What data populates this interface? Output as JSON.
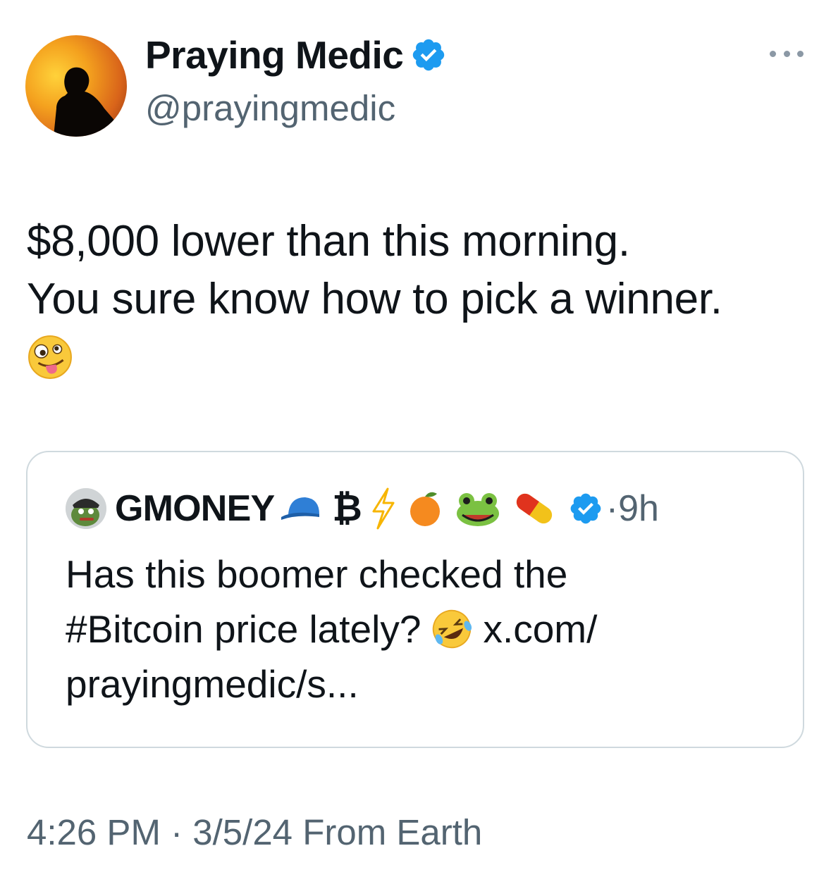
{
  "author": {
    "name": "Praying Medic",
    "handle": "@prayingmedic",
    "verified": true,
    "avatar_icon": "silhouette-sunset-avatar"
  },
  "tweet": {
    "line1": "$8,000 lower than this morning.",
    "line2": "You sure know how to pick a winner.",
    "emoji_icon": "zany-face-emoji"
  },
  "quote": {
    "name": "GMONEY",
    "name_emojis": [
      "cap-icon",
      "₿",
      "lightning-icon",
      "orange-icon",
      "frog-icon",
      "pill-icon"
    ],
    "bitcoin_symbol": "₿",
    "separator": "·",
    "time": "9h",
    "text_line1": "Has this boomer checked the",
    "text_line2_a": "#Bitcoin price lately?",
    "text_line2_b": "x.com/",
    "text_line3": "prayingmedic/s...",
    "text_emoji_icon": "rolling-on-floor-laughing-emoji"
  },
  "meta": {
    "timestamp": "4:26 PM · 3/5/24 From Earth"
  },
  "colors": {
    "verified_blue": "#1d9bf0",
    "secondary_text": "#536471",
    "border": "#cfd9de"
  }
}
